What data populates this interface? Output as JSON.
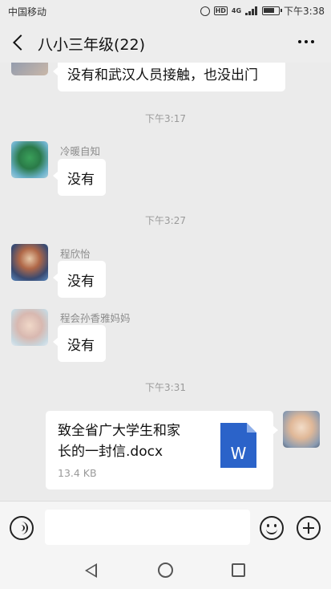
{
  "status_bar": {
    "carrier": "中国移动",
    "network": "4G",
    "hd": "HD",
    "time": "下午3:38"
  },
  "header": {
    "title": "八小三年级(22)",
    "back_icon": "chevron-left-icon",
    "more_icon": "more-dots-icon"
  },
  "messages": [
    {
      "type": "text",
      "sender": "",
      "text": "没有和武汉人员接触，也没出门"
    },
    {
      "type": "time",
      "text": "下午3:17"
    },
    {
      "type": "text",
      "sender": "冷暖自知",
      "text": "没有"
    },
    {
      "type": "time",
      "text": "下午3:27"
    },
    {
      "type": "text",
      "sender": "程欣怡",
      "text": "没有"
    },
    {
      "type": "text",
      "sender": "程会孙香雅妈妈",
      "text": "没有"
    },
    {
      "type": "time",
      "text": "下午3:31"
    },
    {
      "type": "file",
      "file_name": "致全省广大学生和家长的一封信.docx",
      "file_name_line1": "致全省广大学生和家",
      "file_name_line2": "长的一封信.docx",
      "file_size": "13.4 KB",
      "file_icon_letter": "W"
    }
  ],
  "input_bar": {
    "voice_icon": "voice-icon",
    "emoji_icon": "emoji-icon",
    "plus_icon": "plus-icon",
    "placeholder": ""
  },
  "nav_bar": {
    "back_icon": "nav-back-icon",
    "home_icon": "nav-home-icon",
    "recent_icon": "nav-recent-icon"
  },
  "colors": {
    "background": "#ebebeb",
    "bubble": "#ffffff",
    "word_blue": "#2b63c9"
  }
}
